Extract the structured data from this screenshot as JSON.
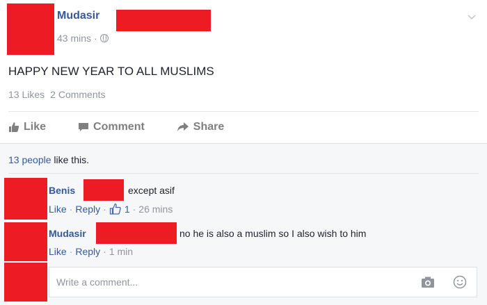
{
  "post": {
    "author": "Mudasir",
    "time": "43 mins",
    "separator": "·",
    "text": "HAPPY NEW YEAR TO ALL MUSLIMS",
    "likes_count": "13 Likes",
    "comments_count": "2 Comments"
  },
  "actions": {
    "like": "Like",
    "comment": "Comment",
    "share": "Share"
  },
  "likes_summary": {
    "link": "13 people",
    "rest": " like this."
  },
  "comments": [
    {
      "name": "Benis",
      "text": "except asif",
      "like": "Like",
      "reply": "Reply",
      "reactions": "1",
      "time": "26 mins"
    },
    {
      "name": "Mudasir",
      "text": "no he is also a muslim so I also wish to him",
      "like": "Like",
      "reply": "Reply",
      "time": "1 min"
    }
  ],
  "composer": {
    "placeholder": "Write a comment..."
  },
  "colors": {
    "redaction": "#ed1c24",
    "link": "#365899",
    "muted": "#90949c"
  }
}
